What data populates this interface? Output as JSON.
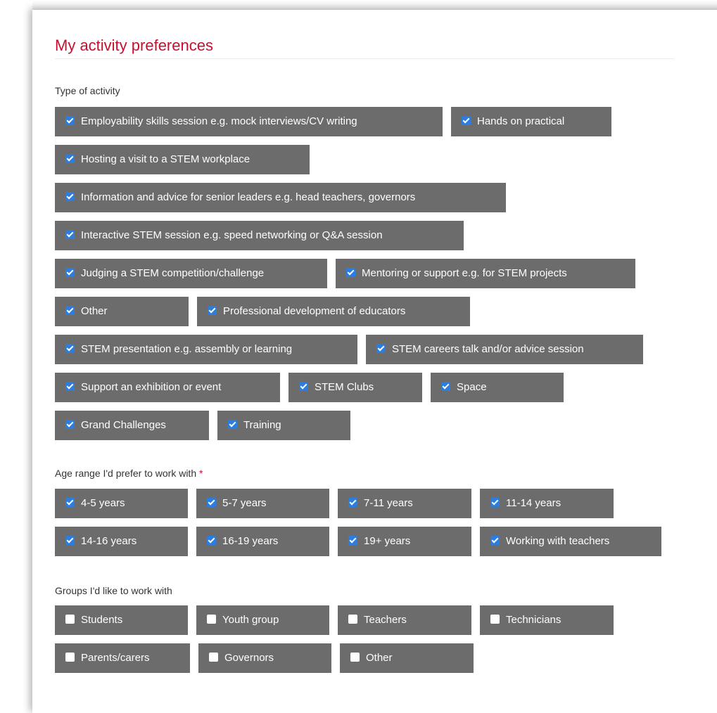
{
  "section_title": "My activity preferences",
  "activity": {
    "label": "Type of activity",
    "options": [
      {
        "label": "Employability skills session e.g. mock interviews/CV writing",
        "checked": true
      },
      {
        "label": "Hands on practical",
        "checked": true
      },
      {
        "label": "Hosting a visit to a STEM workplace",
        "checked": true
      },
      {
        "label": "Information and advice for senior leaders e.g. head teachers, governors",
        "checked": true
      },
      {
        "label": "Interactive STEM session e.g. speed networking or Q&A session",
        "checked": true
      },
      {
        "label": "Judging a STEM competition/challenge",
        "checked": true
      },
      {
        "label": "Mentoring or support e.g. for STEM projects",
        "checked": true
      },
      {
        "label": "Other",
        "checked": true
      },
      {
        "label": "Professional development of educators",
        "checked": true
      },
      {
        "label": "STEM presentation e.g. assembly or learning",
        "checked": true
      },
      {
        "label": "STEM careers talk and/or advice session",
        "checked": true
      },
      {
        "label": "Support an exhibition or event",
        "checked": true
      },
      {
        "label": "STEM Clubs",
        "checked": true
      },
      {
        "label": "Space",
        "checked": true
      },
      {
        "label": "Grand Challenges",
        "checked": true
      },
      {
        "label": "Training",
        "checked": true
      }
    ]
  },
  "age": {
    "label": "Age range I'd prefer to work with",
    "required_mark": "*",
    "options": [
      {
        "label": "4-5 years",
        "checked": true
      },
      {
        "label": "5-7 years",
        "checked": true
      },
      {
        "label": "7-11 years",
        "checked": true
      },
      {
        "label": "11-14 years",
        "checked": true
      },
      {
        "label": "14-16 years",
        "checked": true
      },
      {
        "label": "16-19 years",
        "checked": true
      },
      {
        "label": "19+ years",
        "checked": true
      },
      {
        "label": "Working with teachers",
        "checked": true
      }
    ]
  },
  "groups": {
    "label": "Groups I'd like to work with",
    "options": [
      {
        "label": "Students",
        "checked": false
      },
      {
        "label": "Youth group",
        "checked": false
      },
      {
        "label": "Teachers",
        "checked": false
      },
      {
        "label": "Technicians",
        "checked": false
      },
      {
        "label": "Parents/carers",
        "checked": false
      },
      {
        "label": "Governors",
        "checked": false
      },
      {
        "label": "Other",
        "checked": false
      }
    ]
  },
  "colors": {
    "title": "#c8102e",
    "chip_background": "#6c6c6c",
    "checkbox_checked": "#2a7de1"
  }
}
